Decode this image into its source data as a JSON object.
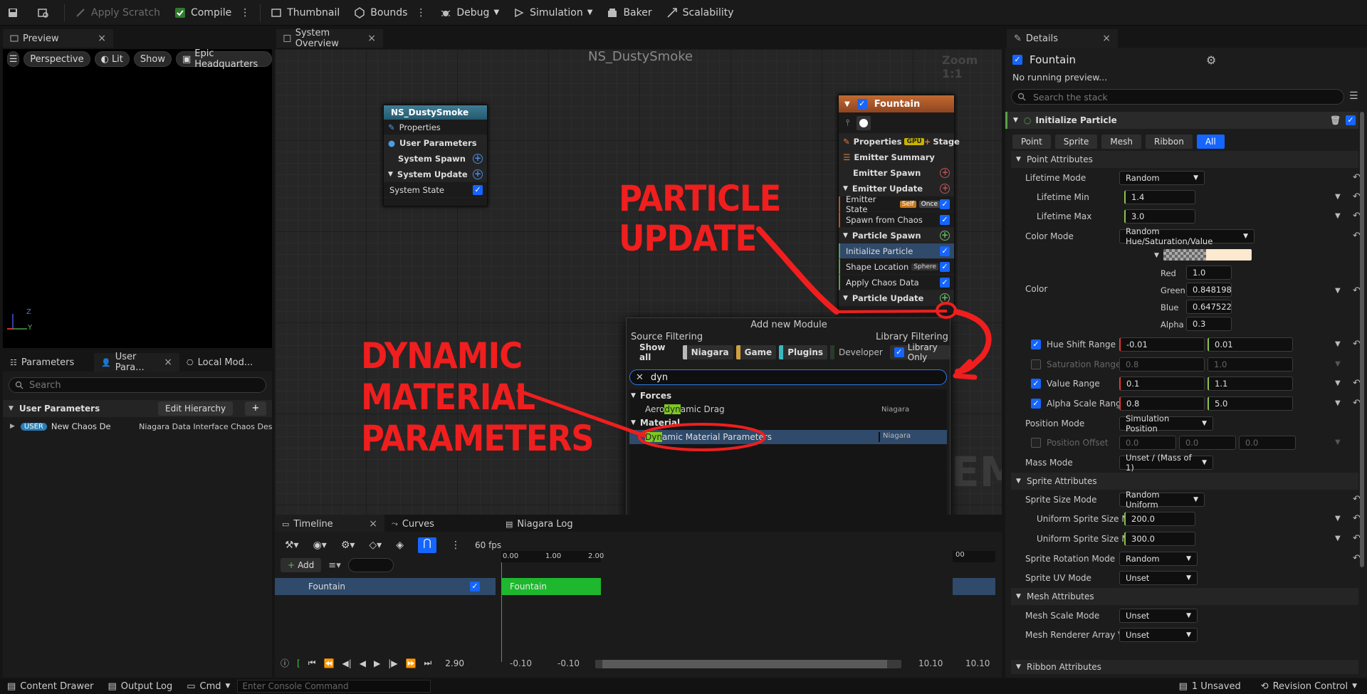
{
  "toolbar": {
    "apply_scratch": "Apply Scratch",
    "compile": "Compile",
    "thumbnail": "Thumbnail",
    "bounds": "Bounds",
    "debug": "Debug",
    "simulation": "Simulation",
    "baker": "Baker",
    "scalability": "Scalability"
  },
  "preview": {
    "tab": "Preview",
    "perspective": "Perspective",
    "lit": "Lit",
    "show": "Show",
    "level": "Epic Headquarters",
    "axis_z": "Z",
    "axis_y": "Y"
  },
  "graph": {
    "tab": "System Overview",
    "title": "NS_DustySmoke",
    "zoom": "Zoom 1:1",
    "watermark": "EM",
    "system_node": {
      "title": "NS_DustySmoke",
      "rows": [
        "Properties",
        "User Parameters",
        "System Spawn",
        "System Update",
        "System State"
      ]
    },
    "emitter_node": {
      "title": "Fountain",
      "properties": "Properties",
      "gpu": "GPU",
      "stage": "Stage",
      "emitter_summary": "Emitter Summary",
      "emitter_spawn": "Emitter Spawn",
      "emitter_update": "Emitter Update",
      "emitter_state": "Emitter State",
      "self": "Self",
      "once": "Once",
      "spawn_from_chaos": "Spawn from Chaos",
      "particle_spawn": "Particle Spawn",
      "initialize_particle": "Initialize Particle",
      "shape_location": "Shape Location",
      "sphere": "Sphere",
      "apply_chaos_data": "Apply Chaos Data",
      "particle_update": "Particle Update"
    }
  },
  "annotations": {
    "particle_update": [
      "PARTICLE",
      "UPDATE"
    ],
    "dynamic": [
      "DYNAMIC",
      "MATERIAL",
      "PARAMETERS"
    ]
  },
  "popup": {
    "title": "Add new Module",
    "source_filtering": "Source Filtering",
    "library_filtering": "Library Filtering",
    "show_all": "Show all",
    "niagara": "Niagara",
    "game": "Game",
    "plugins": "Plugins",
    "developer": "Developer",
    "library_only": "Library Only",
    "search_value": "dyn",
    "cat_forces": "Forces",
    "item_aero": "Aerodynamic Drag",
    "aero_pre": "Aero",
    "aero_hl": "dyn",
    "aero_post": "amic Drag",
    "cat_material": "Material",
    "item_dyn_hl": "Dyn",
    "item_dyn_post": "amic Material Parameters",
    "source_tag": "Niagara"
  },
  "params": {
    "tab_parameters": "Parameters",
    "tab_user": "User Para...",
    "tab_local": "Local Mod...",
    "search_placeholder": "Search",
    "header": "User Parameters",
    "edit_hierarchy": "Edit Hierarchy",
    "user_badge": "USER",
    "param_name": "New Chaos De",
    "param_type": "Niagara Data Interface Chaos Destruc"
  },
  "timeline": {
    "tab_timeline": "Timeline",
    "tab_curves": "Curves",
    "tab_log": "Niagara Log",
    "fps": "60 fps",
    "add": "Add",
    "track": "Fountain",
    "bar_label": "Fountain",
    "ruler": [
      "0.00",
      "1.00",
      "2.00"
    ],
    "ruler_end": "00",
    "time": "2.90",
    "range": [
      "-0.10",
      "-0.10",
      "10.10",
      "10.10"
    ]
  },
  "details": {
    "tab": "Details",
    "emitter": "Fountain",
    "no_preview": "No running preview...",
    "search_placeholder": "Search the stack",
    "module": "Initialize Particle",
    "filters": [
      "Point",
      "Sprite",
      "Mesh",
      "Ribbon",
      "All"
    ],
    "point_attributes": "Point Attributes",
    "lifetime_mode": "Lifetime Mode",
    "lifetime_mode_val": "Random",
    "lifetime_min": "Lifetime Min",
    "lifetime_min_val": "1.4",
    "lifetime_max": "Lifetime Max",
    "lifetime_max_val": "3.0",
    "color_mode": "Color Mode",
    "color_mode_val": "Random Hue/Saturation/Value",
    "color": "Color",
    "red": "Red",
    "red_val": "1.0",
    "green": "Green",
    "green_val": "0.848198",
    "blue": "Blue",
    "blue_val": "0.647522",
    "alpha": "Alpha",
    "alpha_val": "0.3",
    "swatch_color": "#fde8d0",
    "hue_shift": "Hue Shift Range",
    "hue_a": "-0.01",
    "hue_b": "0.01",
    "sat_range": "Saturation Range",
    "sat_a": "0.8",
    "sat_b": "1.0",
    "value_range": "Value Range",
    "val_a": "0.1",
    "val_b": "1.1",
    "alpha_scale": "Alpha Scale Range",
    "as_a": "0.8",
    "as_b": "5.0",
    "position_mode": "Position Mode",
    "position_mode_val": "Simulation Position",
    "position_offset": "Position Offset",
    "po_x": "0.0",
    "po_y": "0.0",
    "po_z": "0.0",
    "mass_mode": "Mass Mode",
    "mass_mode_val": "Unset / (Mass of 1)",
    "sprite_attributes": "Sprite Attributes",
    "sprite_size_mode": "Sprite Size Mode",
    "sprite_size_mode_val": "Random Uniform",
    "uss_min": "Uniform Sprite Size Min",
    "uss_min_val": "200.0",
    "uss_max": "Uniform Sprite Size Max",
    "uss_max_val": "300.0",
    "sprite_rot": "Sprite Rotation Mode",
    "sprite_rot_val": "Random",
    "sprite_uv": "Sprite UV Mode",
    "sprite_uv_val": "Unset",
    "mesh_attributes": "Mesh Attributes",
    "mesh_scale": "Mesh Scale Mode",
    "mesh_scale_val": "Unset",
    "mesh_renderer": "Mesh Renderer Array Visibili",
    "mesh_renderer_val": "Unset",
    "ribbon_attributes": "Ribbon Attributes"
  },
  "statusbar": {
    "content_drawer": "Content Drawer",
    "output_log": "Output Log",
    "cmd": "Cmd",
    "console_placeholder": "Enter Console Command",
    "unsaved": "1 Unsaved",
    "revision": "Revision Control"
  },
  "colors": {
    "accent": "#1565ff",
    "annotation": "#f01e1e",
    "highlight": "#7ec820"
  }
}
